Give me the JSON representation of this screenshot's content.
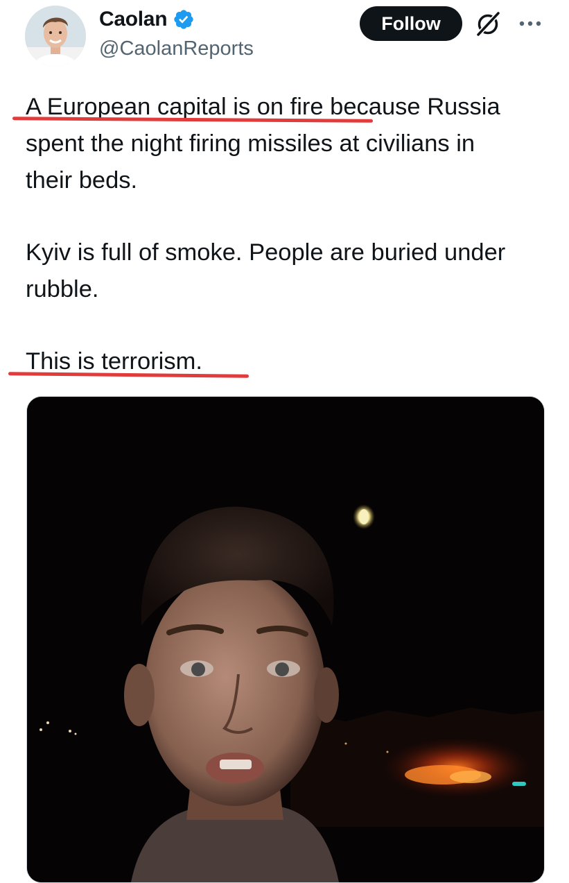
{
  "author": {
    "display_name": "Caolan",
    "handle": "@CaolanReports",
    "verified": true,
    "avatar_icon": "profile-avatar"
  },
  "actions": {
    "follow_label": "Follow",
    "grok_icon": "grok-slash-circle-icon",
    "more_icon": "more-dots-icon"
  },
  "tweet": {
    "lines": [
      "A European capital is on fire because Russia",
      "spent the night firing missiles at civilians in",
      "their beds.",
      "Kyiv is full of smoke. People are buried under",
      "rubble.",
      "This is terrorism."
    ],
    "highlight_color": "#e03c3c"
  },
  "media": {
    "type": "photo",
    "accent_colors": {
      "sky": "#050303",
      "fire": "#ff6a1a",
      "moon": "#f4e9b0"
    }
  },
  "colors": {
    "text": "#0f1419",
    "secondary_text": "#536471",
    "verified_badge": "#1d9bf0",
    "button_bg": "#0f1419"
  }
}
